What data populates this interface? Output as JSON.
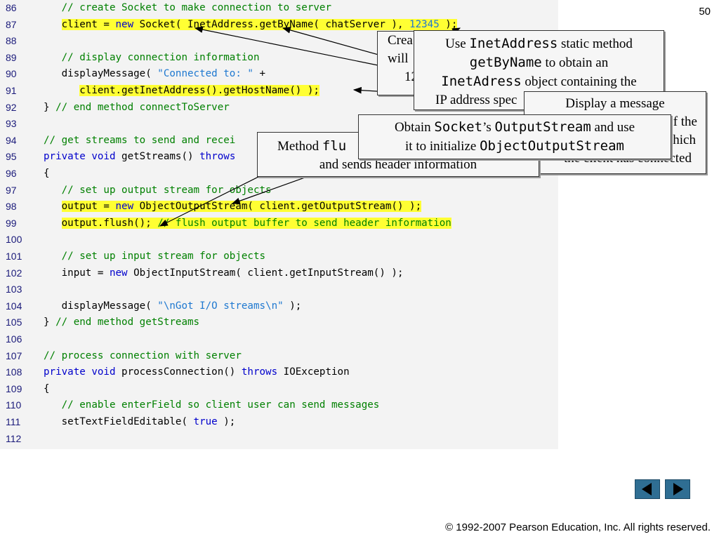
{
  "page_number": "50",
  "footer": "© 1992-2007 Pearson Education, Inc.  All rights reserved.",
  "lines": [
    {
      "n": "86",
      "t": "   // create Socket to make connection to server"
    },
    {
      "n": "87",
      "t": "   client = new Socket( InetAddress.getByName( chatServer ), 12345 );"
    },
    {
      "n": "88",
      "t": ""
    },
    {
      "n": "89",
      "t": "   // display connection information"
    },
    {
      "n": "90",
      "t": "   displayMessage( \"Connected to: \" +"
    },
    {
      "n": "91",
      "t": "      client.getInetAddress().getHostName() );"
    },
    {
      "n": "92",
      "t": "} // end method connectToServer"
    },
    {
      "n": "93",
      "t": ""
    },
    {
      "n": "94",
      "t": "// get streams to send and recei"
    },
    {
      "n": "95",
      "t": "private void getStreams() throws"
    },
    {
      "n": "96",
      "t": "{"
    },
    {
      "n": "97",
      "t": "   // set up output stream for objects"
    },
    {
      "n": "98",
      "t": "   output = new ObjectOutputStream( client.getOutputStream() );"
    },
    {
      "n": "99",
      "t": "   output.flush(); // flush output buffer to send header information"
    },
    {
      "n": "100",
      "t": ""
    },
    {
      "n": "101",
      "t": "   // set up input stream for objects"
    },
    {
      "n": "102",
      "t": "   input = new ObjectInputStream( client.getInputStream() );"
    },
    {
      "n": "103",
      "t": ""
    },
    {
      "n": "104",
      "t": "   displayMessage( \"\\nGot I/O streams\\n\" );"
    },
    {
      "n": "105",
      "t": "} // end method getStreams"
    },
    {
      "n": "106",
      "t": ""
    },
    {
      "n": "107",
      "t": "// process connection with server"
    },
    {
      "n": "108",
      "t": "private void processConnection() throws IOException"
    },
    {
      "n": "109",
      "t": "{"
    },
    {
      "n": "110",
      "t": "   // enable enterField so client user can send messages"
    },
    {
      "n": "111",
      "t": "   setTextFieldEditable( true );"
    },
    {
      "n": "112",
      "t": ""
    }
  ],
  "callouts": {
    "create_socket": {
      "line1": "Crea",
      "line2": "will",
      "line3": "12"
    },
    "getbyname": {
      "a": "Use ",
      "b": "InetAddress",
      "c": " static method",
      "d": "getByName",
      "e": " to obtain an",
      "f": "InetAdress",
      "g": " object containing the",
      "h": "IP address spec"
    },
    "display_message": {
      "line1": "Display a message",
      "line2": "f the",
      "line3": "hich",
      "line4": "the client has connected"
    },
    "flush": {
      "a": "Method ",
      "b": "flu",
      "c": "and sends header information"
    },
    "output_stream": {
      "a": "Obtain ",
      "b": "Socket",
      "c": "’s ",
      "d": "OutputStream",
      "e": " and use",
      "f": "it to initialize ",
      "g": "ObjectOutputStream"
    }
  },
  "nav": {
    "prev": "previous-slide",
    "next": "next-slide"
  }
}
